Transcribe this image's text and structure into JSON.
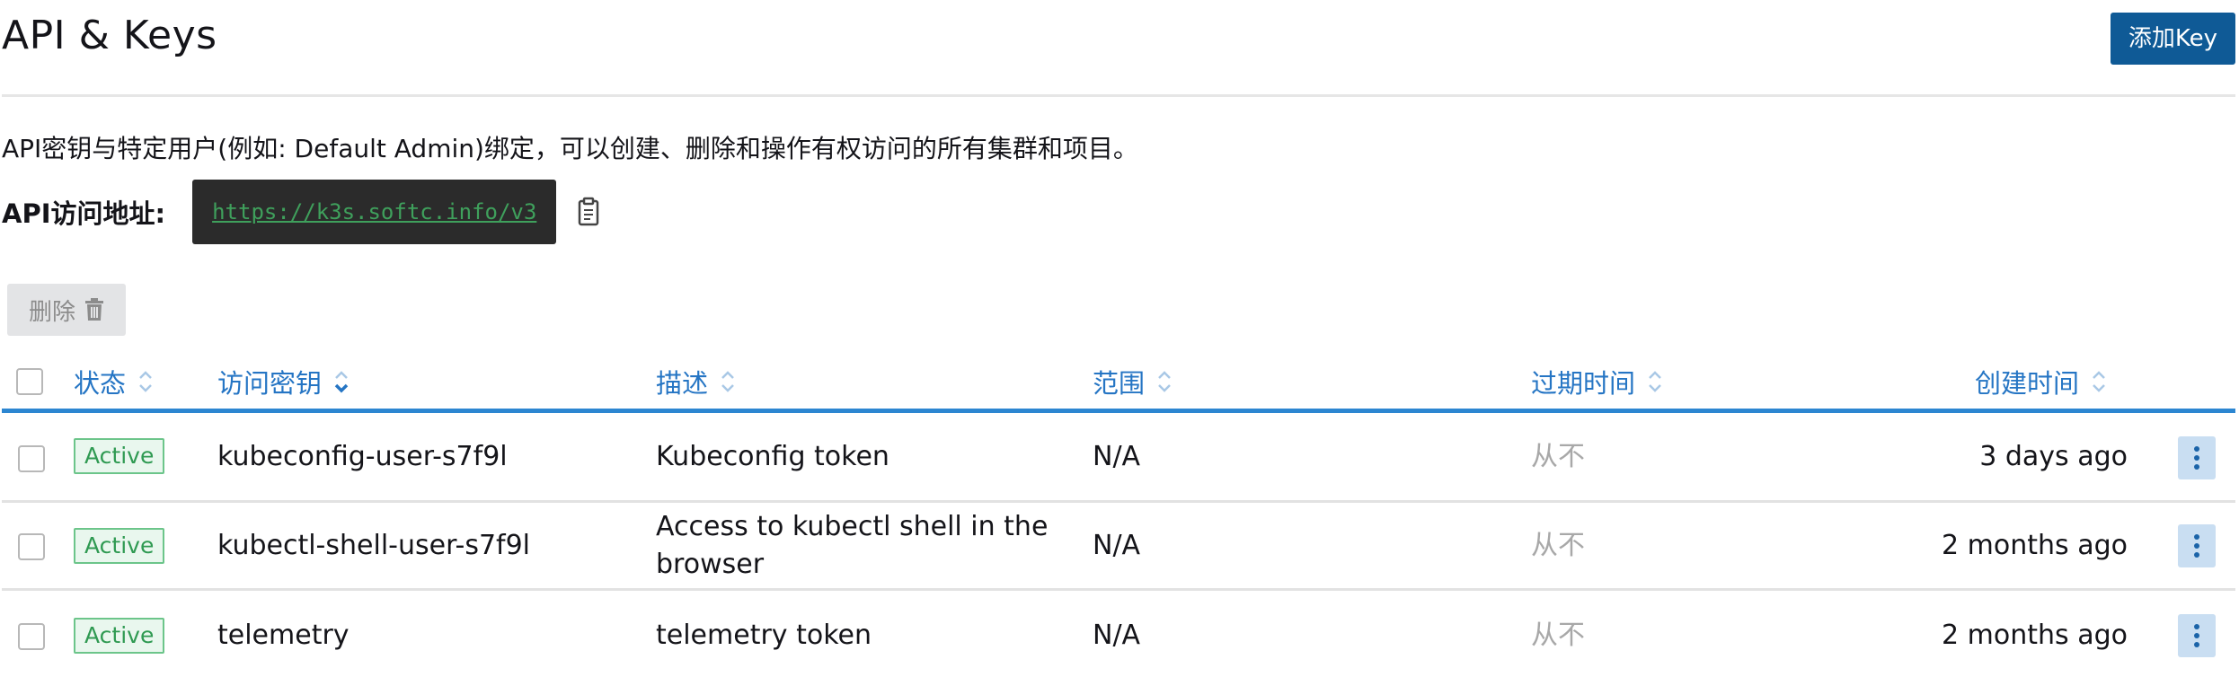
{
  "header": {
    "title": "API & Keys",
    "add_button_label": "添加Key"
  },
  "info": {
    "description": "API密钥与特定用户(例如: Default Admin)绑定，可以创建、删除和操作有权访问的所有集群和项目。",
    "endpoint_label": "API访问地址:",
    "endpoint_url": "https://k3s.softc.info/v3"
  },
  "bulk_actions": {
    "delete_label": "删除"
  },
  "table": {
    "columns": {
      "state": "状态",
      "access_key": "访问密钥",
      "description": "描述",
      "scope": "范围",
      "expires": "过期时间",
      "created": "创建时间"
    },
    "rows": [
      {
        "state": "Active",
        "access_key": "kubeconfig-user-s7f9l",
        "description": "Kubeconfig token",
        "scope": "N/A",
        "expires": "从不",
        "created": "3 days ago"
      },
      {
        "state": "Active",
        "access_key": "kubectl-shell-user-s7f9l",
        "description": "Access to kubectl shell in the browser",
        "scope": "N/A",
        "expires": "从不",
        "created": "2 months ago"
      },
      {
        "state": "Active",
        "access_key": "telemetry",
        "description": "telemetry token",
        "scope": "N/A",
        "expires": "从不",
        "created": "2 months ago"
      }
    ]
  },
  "icons": {
    "copy": "clipboard-icon",
    "delete": "trash-icon",
    "sort": "sort-icon",
    "row_action": "kebab-menu-icon"
  },
  "colors": {
    "primary": "#0f5a96",
    "link": "#2575c4",
    "active_text": "#2f9a52",
    "active_bg": "#e9f7ee",
    "muted": "#a8a8a8"
  }
}
